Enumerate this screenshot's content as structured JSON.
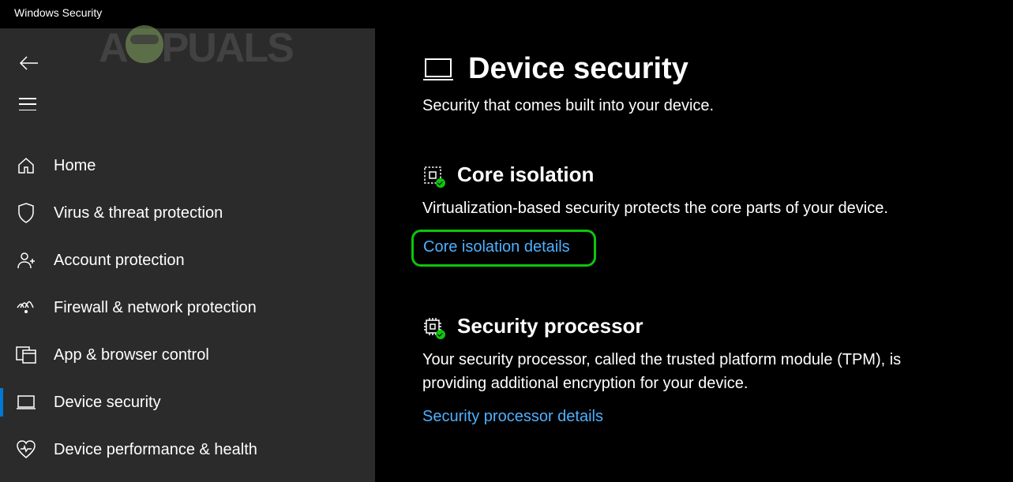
{
  "app": {
    "title": "Windows Security"
  },
  "watermark": {
    "prefix": "A",
    "suffix": "PUALS"
  },
  "nav": {
    "items": [
      {
        "label": "Home",
        "icon": "home"
      },
      {
        "label": "Virus & threat protection",
        "icon": "shield"
      },
      {
        "label": "Account protection",
        "icon": "account"
      },
      {
        "label": "Firewall & network protection",
        "icon": "network"
      },
      {
        "label": "App & browser control",
        "icon": "appbrowser"
      },
      {
        "label": "Device security",
        "icon": "device",
        "active": true
      },
      {
        "label": "Device performance & health",
        "icon": "heart"
      }
    ]
  },
  "page": {
    "title": "Device security",
    "subtitle": "Security that comes built into your device."
  },
  "sections": {
    "core_isolation": {
      "title": "Core isolation",
      "desc": "Virtualization-based security protects the core parts of your device.",
      "link": "Core isolation details"
    },
    "security_processor": {
      "title": "Security processor",
      "desc": "Your security processor, called the trusted platform module (TPM), is providing additional encryption for your device.",
      "link": "Security processor details"
    }
  }
}
